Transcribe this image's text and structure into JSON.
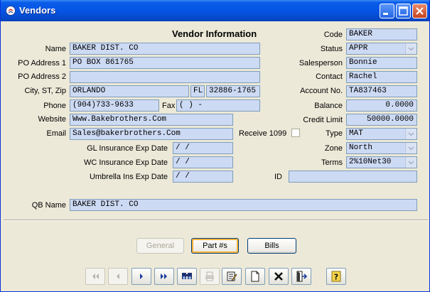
{
  "window": {
    "title": "Vendors"
  },
  "form": {
    "heading": "Vendor Information",
    "name": {
      "label": "Name",
      "value": "BAKER DIST. CO"
    },
    "po_address1": {
      "label": "PO Address 1",
      "value": "PO BOX 861765"
    },
    "po_address2": {
      "label": "PO Address 2",
      "value": ""
    },
    "city_state_zip": {
      "label": "City, ST, Zip",
      "city": "ORLANDO",
      "state": "FL",
      "zip": "32886-1765"
    },
    "phone": {
      "label": "Phone",
      "value": "(904)733-9633"
    },
    "fax": {
      "label": "Fax",
      "value": "(   )    -"
    },
    "website": {
      "label": "Website",
      "value": "Www.Bakebrothers.Com"
    },
    "email": {
      "label": "Email",
      "value": "Sales@bakerbrothers.Com"
    },
    "receive_1099": {
      "label": "Receive 1099",
      "checked": false
    },
    "gl_insurance": {
      "label": "GL Insurance Exp Date",
      "value": "  /  /"
    },
    "wc_insurance": {
      "label": "WC Insurance Exp Date",
      "value": "  /  /"
    },
    "umbrella": {
      "label": "Umbrella Ins Exp Date",
      "value": "  /  /"
    },
    "code": {
      "label": "Code",
      "value": "BAKER"
    },
    "status": {
      "label": "Status",
      "value": "APPR"
    },
    "salesperson": {
      "label": "Salesperson",
      "value": "Bonnie"
    },
    "contact": {
      "label": "Contact",
      "value": "Rachel"
    },
    "account_no": {
      "label": "Account No.",
      "value": "TA837463"
    },
    "balance": {
      "label": "Balance",
      "value": "0.0000"
    },
    "credit_limit": {
      "label": "Credit Limit",
      "value": "50000.0000"
    },
    "type": {
      "label": "Type",
      "value": "MAT"
    },
    "zone": {
      "label": "Zone",
      "value": "North"
    },
    "terms": {
      "label": "Terms",
      "value": "2%10Net30"
    },
    "id": {
      "label": "ID",
      "value": ""
    },
    "qb_name": {
      "label": "QB Name",
      "value": "BAKER DIST. CO"
    }
  },
  "tabs": {
    "general": "General",
    "parts": "Part #s",
    "bills": "Bills"
  },
  "toolbar": {
    "icons": [
      "first-record-icon",
      "previous-record-icon",
      "next-record-icon",
      "last-record-icon",
      "find-icon",
      "print-icon",
      "edit-icon",
      "new-record-icon",
      "delete-icon",
      "exit-icon",
      "help-icon"
    ]
  },
  "colors": {
    "field_bg": "#CDDAF4",
    "titlebar": "#0655E6",
    "window_bg": "#ECE9D8"
  }
}
